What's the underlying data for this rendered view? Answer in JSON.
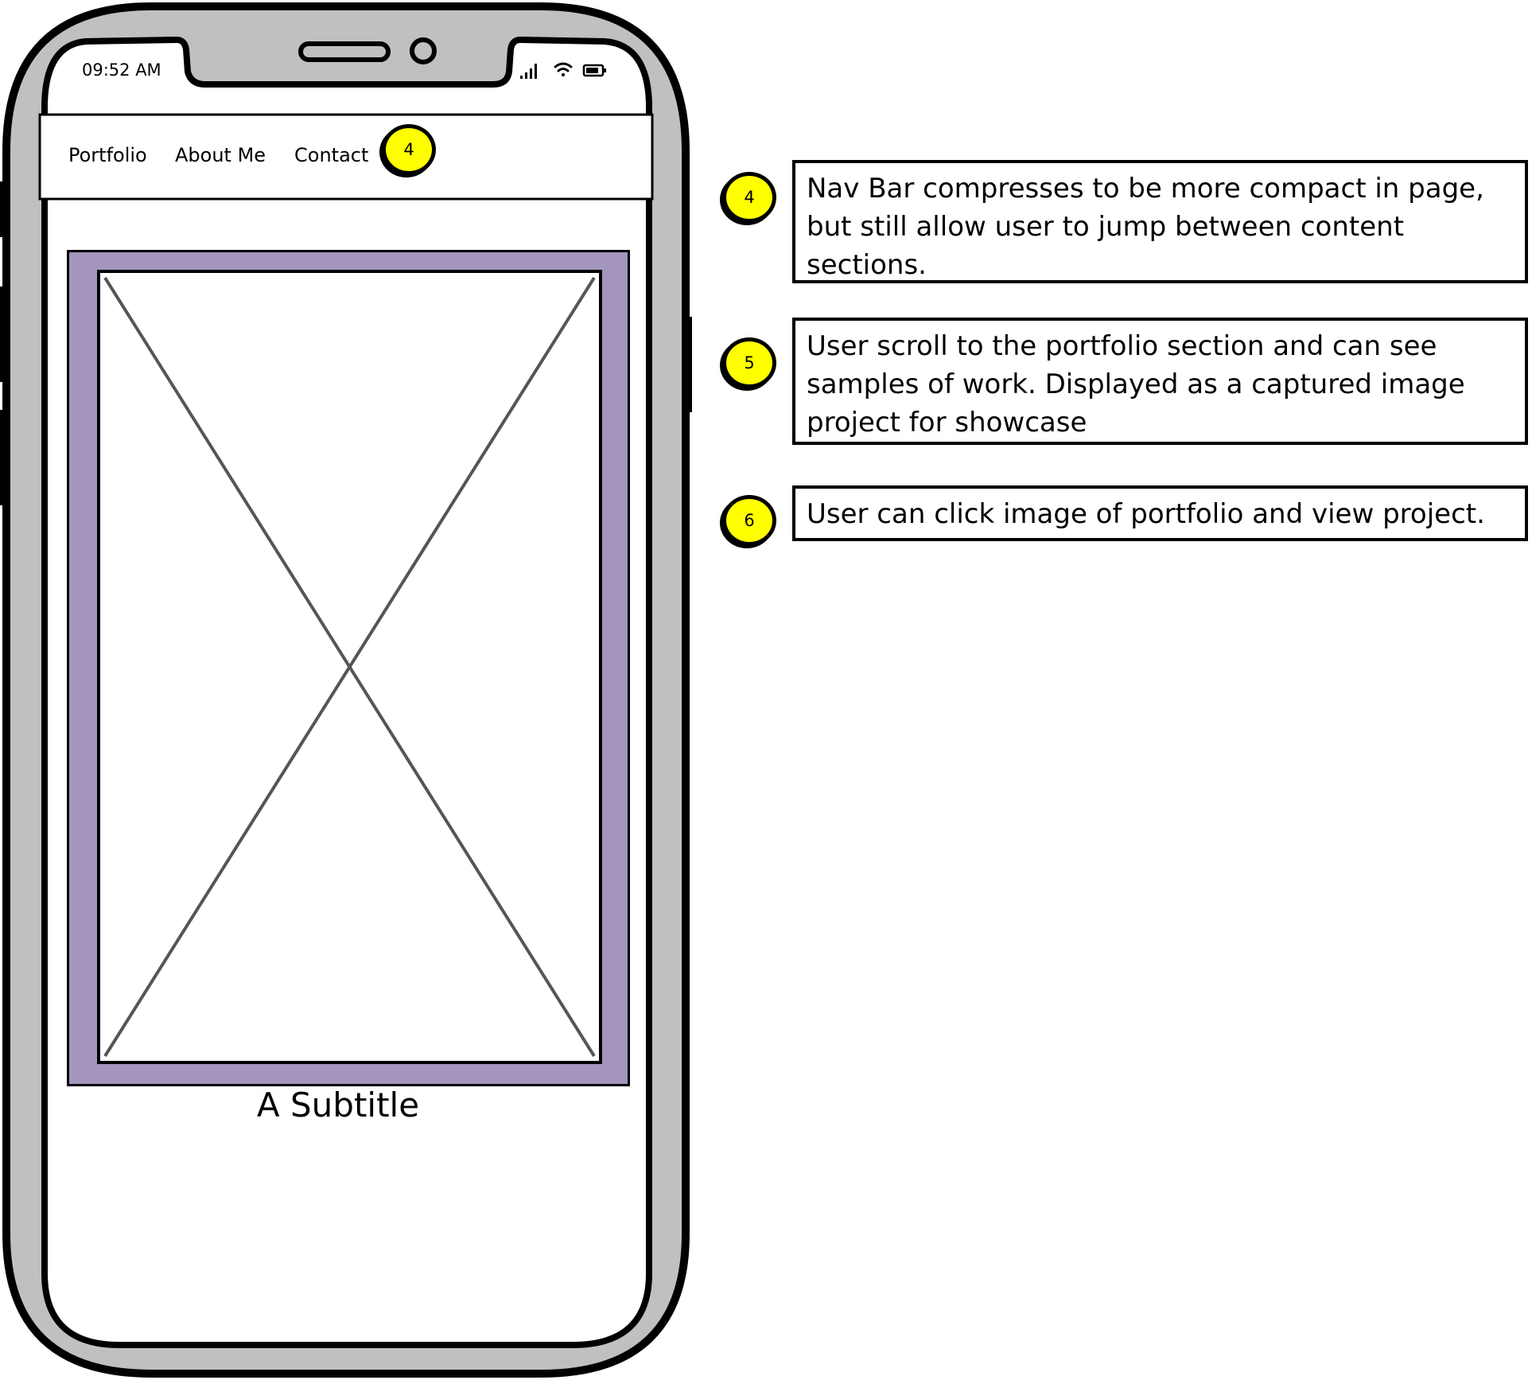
{
  "status_bar": {
    "time": "09:52 AM",
    "icons": [
      "signal-icon",
      "wifi-icon",
      "battery-icon"
    ]
  },
  "navbar": {
    "links": [
      "Portfolio",
      "About Me",
      "Contact"
    ],
    "badge": "4"
  },
  "portfolio": {
    "image": "image-placeholder",
    "subtitle": "A Subtitle"
  },
  "annotations": [
    {
      "number": "4",
      "text": "Nav Bar compresses to be more compact in page, but still allow user to jump between content sections."
    },
    {
      "number": "5",
      "text": "User scroll to the portfolio section and can see samples of work. Displayed as a captured image project for showcase"
    },
    {
      "number": "6",
      "text": "User can click image of portfolio and view project."
    }
  ],
  "colors": {
    "badge": "#ffff00",
    "frame": "#a395bc",
    "phone_body": "#c0c0c0"
  }
}
